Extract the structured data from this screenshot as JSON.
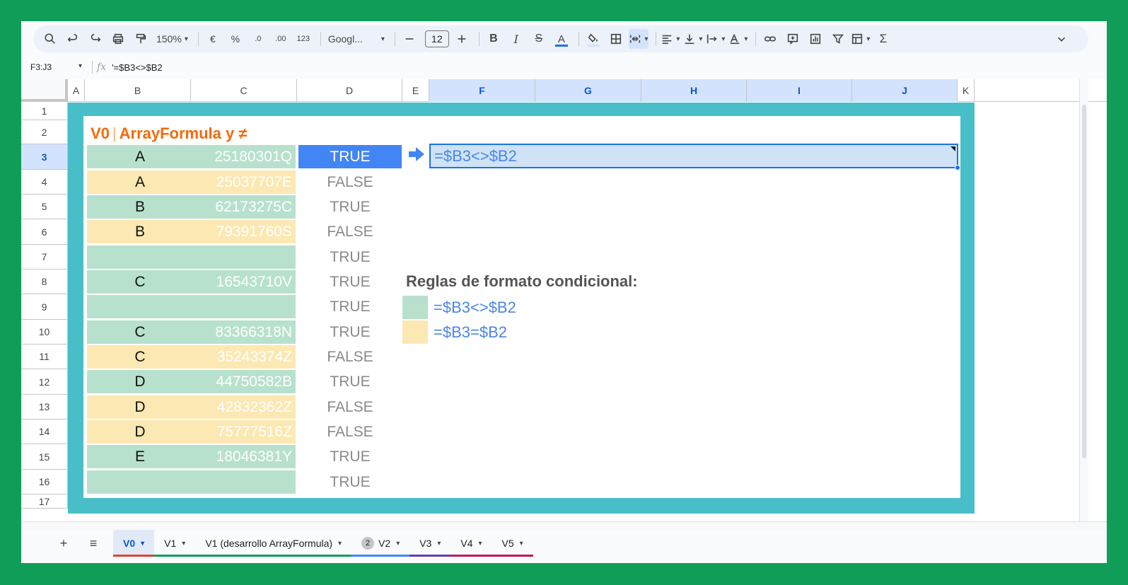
{
  "toolbar": {
    "zoom": "150%",
    "currency": "€",
    "percent": "%",
    "dec_decrease": ".0",
    "dec_increase": ".00",
    "number_format": "123",
    "font": "Googl...",
    "font_size": "12"
  },
  "formula_bar": {
    "range": "F3:J3",
    "fx": "fx",
    "formula": "'=$B3<>$B2"
  },
  "columns": [
    "A",
    "B",
    "C",
    "D",
    "E",
    "F",
    "G",
    "H",
    "I",
    "J",
    "K"
  ],
  "rows": [
    "1",
    "2",
    "3",
    "4",
    "5",
    "6",
    "7",
    "8",
    "9",
    "10",
    "11",
    "12",
    "13",
    "14",
    "15",
    "16",
    "17"
  ],
  "title": {
    "prefix": "V0",
    "separator": "|",
    "text": "ArrayFormula y ≠"
  },
  "data_rows": [
    {
      "b": "A",
      "c": "25180301Q",
      "d": "TRUE"
    },
    {
      "b": "A",
      "c": "25037707E",
      "d": "FALSE"
    },
    {
      "b": "B",
      "c": "62173275C",
      "d": "TRUE"
    },
    {
      "b": "B",
      "c": "79391760S",
      "d": "FALSE"
    },
    {
      "b": "",
      "c": "",
      "d": "TRUE"
    },
    {
      "b": "C",
      "c": "16543710V",
      "d": "TRUE"
    },
    {
      "b": "",
      "c": "",
      "d": "TRUE"
    },
    {
      "b": "C",
      "c": "83366318N",
      "d": "TRUE"
    },
    {
      "b": "C",
      "c": "35243374Z",
      "d": "FALSE"
    },
    {
      "b": "D",
      "c": "44750582B",
      "d": "TRUE"
    },
    {
      "b": "D",
      "c": "42832362Z",
      "d": "FALSE"
    },
    {
      "b": "D",
      "c": "75777516Z",
      "d": "FALSE"
    },
    {
      "b": "E",
      "c": "18046381Y",
      "d": "TRUE"
    },
    {
      "b": "",
      "c": "",
      "d": "TRUE"
    }
  ],
  "formula_cell": "=$B3<>$B2",
  "rules": {
    "title": "Reglas de formato condicional:",
    "items": [
      {
        "formula": "=$B3<>$B2",
        "color": "#b7e1cd"
      },
      {
        "formula": "=$B3=$B2",
        "color": "#fce8b2"
      }
    ]
  },
  "sheets": [
    {
      "name": "V0",
      "active": true,
      "color": "#db4437",
      "badge": ""
    },
    {
      "name": "V1",
      "active": false,
      "color": "#0f9d58",
      "badge": ""
    },
    {
      "name": "V1 (desarrollo ArrayFormula)",
      "active": false,
      "color": "#0f9d58",
      "badge": ""
    },
    {
      "name": "V2",
      "active": false,
      "color": "#4285f4",
      "badge": "2"
    },
    {
      "name": "V3",
      "active": false,
      "color": "#673ab7",
      "badge": ""
    },
    {
      "name": "V4",
      "active": false,
      "color": "#c2185b",
      "badge": ""
    },
    {
      "name": "V5",
      "active": false,
      "color": "#c2185b",
      "badge": ""
    }
  ],
  "colors": {
    "frame": "#0f9d58",
    "teal": "#48bfc8",
    "title_orange": "#f46a0a",
    "rule_blue": "#4a86e8"
  }
}
